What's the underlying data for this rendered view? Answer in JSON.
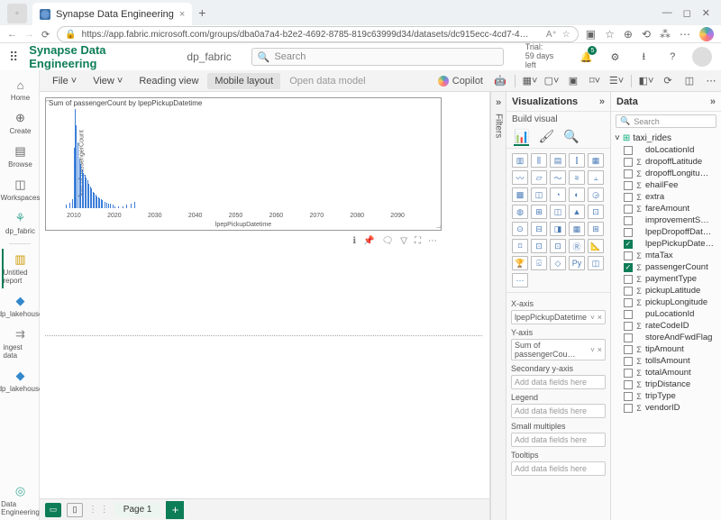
{
  "browser": {
    "tab_title": "Synapse Data Engineering",
    "url": "https://app.fabric.microsoft.com/groups/dba0a7a4-b2e2-4692-8785-819c63999d34/datasets/dc915ecc-4cd7-4…"
  },
  "header": {
    "workspace": "Synapse Data Engineering",
    "breadcrumb": "dp_fabric",
    "search_placeholder": "Search",
    "trial_line1": "Trial:",
    "trial_line2": "59 days left",
    "notif_count": "5"
  },
  "ribbon": {
    "file": "File",
    "view": "View",
    "reading": "Reading view",
    "mobile": "Mobile layout",
    "open_model": "Open data model",
    "copilot": "Copilot"
  },
  "rail": {
    "home": "Home",
    "create": "Create",
    "browse": "Browse",
    "workspaces": "Workspaces",
    "dp_fabric": "dp_fabric",
    "untitled": "Untitled report",
    "lakehouse": "dp_lakehouse",
    "ingest": "ingest data",
    "lakehouse2": "dp_lakehouse",
    "data_eng": "Data Engineering"
  },
  "pages": {
    "page1": "Page 1"
  },
  "filters_label": "Filters",
  "viz": {
    "title": "Visualizations",
    "build": "Build visual",
    "xaxis": "X-axis",
    "xaxis_val": "lpepPickupDatetime",
    "yaxis": "Y-axis",
    "yaxis_val": "Sum of passengerCou…",
    "secondary": "Secondary y-axis",
    "legend": "Legend",
    "small_mult": "Small multiples",
    "tooltips": "Tooltips",
    "placeholder": "Add data fields here"
  },
  "data": {
    "title": "Data",
    "search": "Search",
    "table": "taxi_rides",
    "fields": [
      {
        "n": "doLocationId",
        "sigma": false,
        "checked": false
      },
      {
        "n": "dropoffLatitude",
        "sigma": true,
        "checked": false
      },
      {
        "n": "dropoffLongitu…",
        "sigma": true,
        "checked": false
      },
      {
        "n": "ehailFee",
        "sigma": true,
        "checked": false
      },
      {
        "n": "extra",
        "sigma": true,
        "checked": false
      },
      {
        "n": "fareAmount",
        "sigma": true,
        "checked": false
      },
      {
        "n": "improvementS…",
        "sigma": false,
        "checked": false
      },
      {
        "n": "lpepDropoffDat…",
        "sigma": false,
        "checked": false
      },
      {
        "n": "lpepPickupDate…",
        "sigma": false,
        "checked": true
      },
      {
        "n": "mtaTax",
        "sigma": true,
        "checked": false
      },
      {
        "n": "passengerCount",
        "sigma": true,
        "checked": true
      },
      {
        "n": "paymentType",
        "sigma": true,
        "checked": false
      },
      {
        "n": "pickupLatitude",
        "sigma": true,
        "checked": false
      },
      {
        "n": "pickupLongitude",
        "sigma": true,
        "checked": false
      },
      {
        "n": "puLocationId",
        "sigma": false,
        "checked": false
      },
      {
        "n": "rateCodeID",
        "sigma": true,
        "checked": false
      },
      {
        "n": "storeAndFwdFlag",
        "sigma": false,
        "checked": false
      },
      {
        "n": "tipAmount",
        "sigma": true,
        "checked": false
      },
      {
        "n": "tollsAmount",
        "sigma": true,
        "checked": false
      },
      {
        "n": "totalAmount",
        "sigma": true,
        "checked": false
      },
      {
        "n": "tripDistance",
        "sigma": true,
        "checked": false
      },
      {
        "n": "tripType",
        "sigma": true,
        "checked": false
      },
      {
        "n": "vendorID",
        "sigma": true,
        "checked": false
      }
    ]
  },
  "chart_data": {
    "type": "bar",
    "title": "Sum of passengerCount by lpepPickupDatetime",
    "xlabel": "lpepPickupDatetime",
    "ylabel": "Sum of passengerCount",
    "xticks": [
      "2010",
      "2020",
      "2030",
      "2040",
      "2050",
      "2060",
      "2070",
      "2080",
      "2090"
    ],
    "xlim": [
      2008,
      2100
    ],
    "series": [
      {
        "name": "passengerCount",
        "x": [
          2008,
          2009,
          2009.5,
          2010,
          2010.2,
          2010.5,
          2010.8,
          2011,
          2011.3,
          2011.6,
          2012,
          2012.3,
          2012.6,
          2013,
          2013.3,
          2013.6,
          2014,
          2014.3,
          2014.6,
          2015,
          2015.3,
          2015.6,
          2016,
          2016.3,
          2016.6,
          2017,
          2017.5,
          2018,
          2018.5,
          2019,
          2019.5,
          2020,
          2021,
          2022,
          2023,
          2024,
          2025
        ],
        "values": [
          3,
          5,
          8,
          55,
          90,
          75,
          60,
          50,
          45,
          40,
          35,
          32,
          30,
          28,
          25,
          22,
          20,
          18,
          15,
          14,
          12,
          11,
          10,
          9,
          8,
          7,
          6,
          5,
          4,
          4,
          3,
          2,
          2,
          2,
          3,
          4,
          6
        ]
      }
    ]
  }
}
